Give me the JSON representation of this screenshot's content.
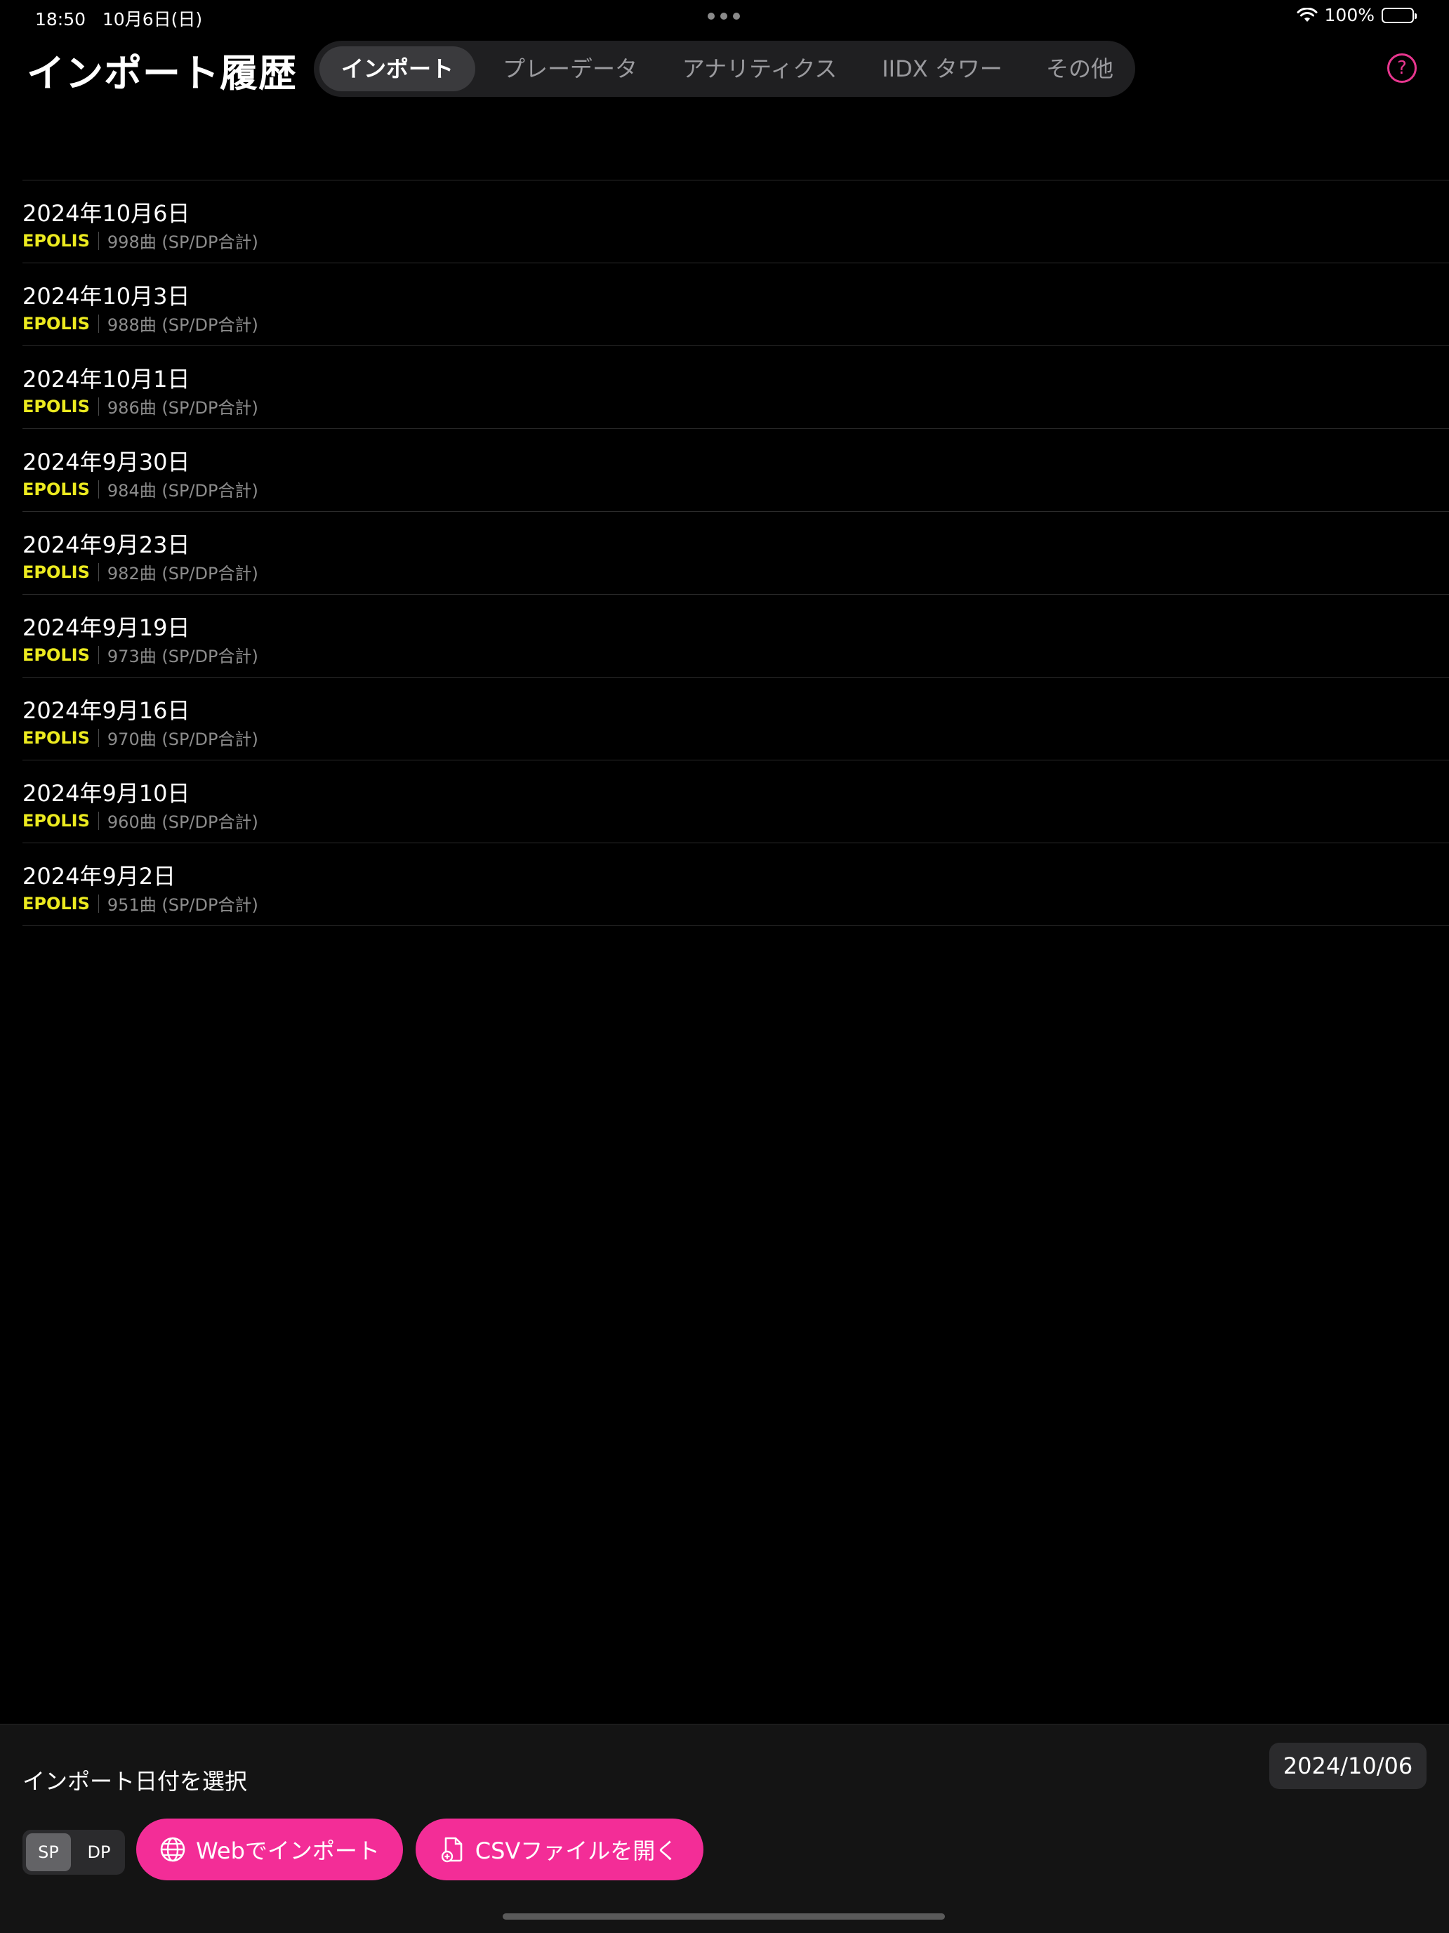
{
  "status_bar": {
    "time": "18:50",
    "date": "10月6日(日)",
    "battery": "100%"
  },
  "header": {
    "title": "インポート履歴",
    "tabs": [
      {
        "label": "インポート",
        "active": true
      },
      {
        "label": "プレーデータ",
        "active": false
      },
      {
        "label": "アナリティクス",
        "active": false
      },
      {
        "label": "IIDX タワー",
        "active": false
      },
      {
        "label": "その他",
        "active": false
      }
    ],
    "help_icon": "question-circle-icon"
  },
  "imports": [
    {
      "date": "2024年10月6日",
      "version": "EPOLIS",
      "count": "998曲 (SP/DP合計)"
    },
    {
      "date": "2024年10月3日",
      "version": "EPOLIS",
      "count": "988曲 (SP/DP合計)"
    },
    {
      "date": "2024年10月1日",
      "version": "EPOLIS",
      "count": "986曲 (SP/DP合計)"
    },
    {
      "date": "2024年9月30日",
      "version": "EPOLIS",
      "count": "984曲 (SP/DP合計)"
    },
    {
      "date": "2024年9月23日",
      "version": "EPOLIS",
      "count": "982曲 (SP/DP合計)"
    },
    {
      "date": "2024年9月19日",
      "version": "EPOLIS",
      "count": "973曲 (SP/DP合計)"
    },
    {
      "date": "2024年9月16日",
      "version": "EPOLIS",
      "count": "970曲 (SP/DP合計)"
    },
    {
      "date": "2024年9月10日",
      "version": "EPOLIS",
      "count": "960曲 (SP/DP合計)"
    },
    {
      "date": "2024年9月2日",
      "version": "EPOLIS",
      "count": "951曲 (SP/DP合計)"
    }
  ],
  "bottom": {
    "date_label": "インポート日付を選択",
    "selected_date": "2024/10/06",
    "play_mode": {
      "options": [
        "SP",
        "DP"
      ],
      "selected": "SP"
    },
    "web_import_label": "Webでインポート",
    "csv_open_label": "CSVファイルを開く"
  },
  "colors": {
    "accent": "#f32d97",
    "version": "#ecea1f",
    "background": "#000000"
  }
}
